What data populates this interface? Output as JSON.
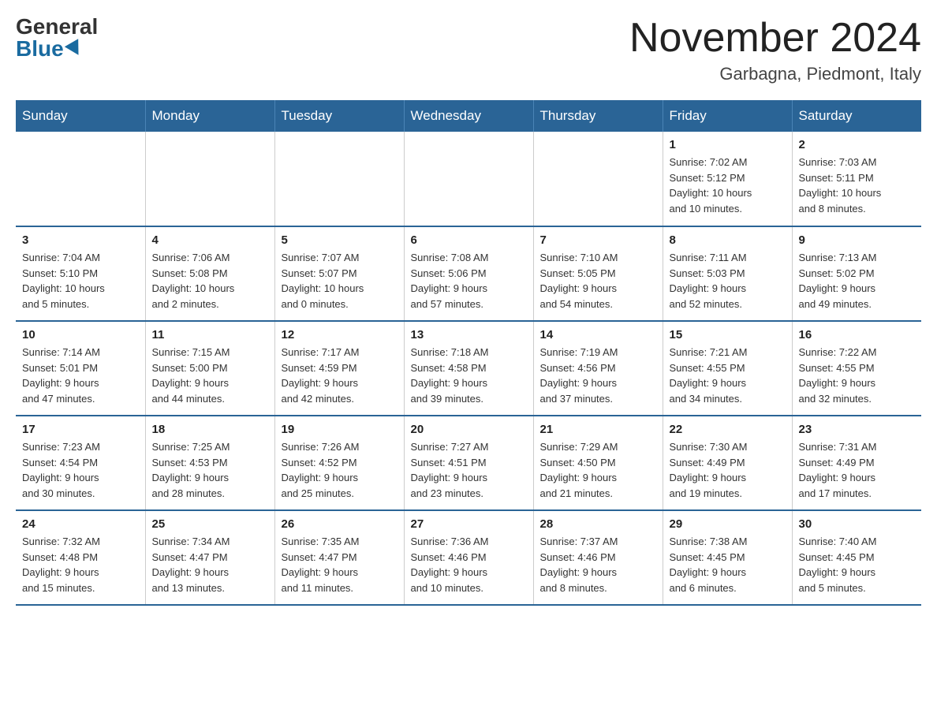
{
  "header": {
    "logo_general": "General",
    "logo_blue": "Blue",
    "month_title": "November 2024",
    "location": "Garbagna, Piedmont, Italy"
  },
  "days_of_week": [
    "Sunday",
    "Monday",
    "Tuesday",
    "Wednesday",
    "Thursday",
    "Friday",
    "Saturday"
  ],
  "weeks": [
    [
      {
        "day": "",
        "info": ""
      },
      {
        "day": "",
        "info": ""
      },
      {
        "day": "",
        "info": ""
      },
      {
        "day": "",
        "info": ""
      },
      {
        "day": "",
        "info": ""
      },
      {
        "day": "1",
        "info": "Sunrise: 7:02 AM\nSunset: 5:12 PM\nDaylight: 10 hours\nand 10 minutes."
      },
      {
        "day": "2",
        "info": "Sunrise: 7:03 AM\nSunset: 5:11 PM\nDaylight: 10 hours\nand 8 minutes."
      }
    ],
    [
      {
        "day": "3",
        "info": "Sunrise: 7:04 AM\nSunset: 5:10 PM\nDaylight: 10 hours\nand 5 minutes."
      },
      {
        "day": "4",
        "info": "Sunrise: 7:06 AM\nSunset: 5:08 PM\nDaylight: 10 hours\nand 2 minutes."
      },
      {
        "day": "5",
        "info": "Sunrise: 7:07 AM\nSunset: 5:07 PM\nDaylight: 10 hours\nand 0 minutes."
      },
      {
        "day": "6",
        "info": "Sunrise: 7:08 AM\nSunset: 5:06 PM\nDaylight: 9 hours\nand 57 minutes."
      },
      {
        "day": "7",
        "info": "Sunrise: 7:10 AM\nSunset: 5:05 PM\nDaylight: 9 hours\nand 54 minutes."
      },
      {
        "day": "8",
        "info": "Sunrise: 7:11 AM\nSunset: 5:03 PM\nDaylight: 9 hours\nand 52 minutes."
      },
      {
        "day": "9",
        "info": "Sunrise: 7:13 AM\nSunset: 5:02 PM\nDaylight: 9 hours\nand 49 minutes."
      }
    ],
    [
      {
        "day": "10",
        "info": "Sunrise: 7:14 AM\nSunset: 5:01 PM\nDaylight: 9 hours\nand 47 minutes."
      },
      {
        "day": "11",
        "info": "Sunrise: 7:15 AM\nSunset: 5:00 PM\nDaylight: 9 hours\nand 44 minutes."
      },
      {
        "day": "12",
        "info": "Sunrise: 7:17 AM\nSunset: 4:59 PM\nDaylight: 9 hours\nand 42 minutes."
      },
      {
        "day": "13",
        "info": "Sunrise: 7:18 AM\nSunset: 4:58 PM\nDaylight: 9 hours\nand 39 minutes."
      },
      {
        "day": "14",
        "info": "Sunrise: 7:19 AM\nSunset: 4:56 PM\nDaylight: 9 hours\nand 37 minutes."
      },
      {
        "day": "15",
        "info": "Sunrise: 7:21 AM\nSunset: 4:55 PM\nDaylight: 9 hours\nand 34 minutes."
      },
      {
        "day": "16",
        "info": "Sunrise: 7:22 AM\nSunset: 4:55 PM\nDaylight: 9 hours\nand 32 minutes."
      }
    ],
    [
      {
        "day": "17",
        "info": "Sunrise: 7:23 AM\nSunset: 4:54 PM\nDaylight: 9 hours\nand 30 minutes."
      },
      {
        "day": "18",
        "info": "Sunrise: 7:25 AM\nSunset: 4:53 PM\nDaylight: 9 hours\nand 28 minutes."
      },
      {
        "day": "19",
        "info": "Sunrise: 7:26 AM\nSunset: 4:52 PM\nDaylight: 9 hours\nand 25 minutes."
      },
      {
        "day": "20",
        "info": "Sunrise: 7:27 AM\nSunset: 4:51 PM\nDaylight: 9 hours\nand 23 minutes."
      },
      {
        "day": "21",
        "info": "Sunrise: 7:29 AM\nSunset: 4:50 PM\nDaylight: 9 hours\nand 21 minutes."
      },
      {
        "day": "22",
        "info": "Sunrise: 7:30 AM\nSunset: 4:49 PM\nDaylight: 9 hours\nand 19 minutes."
      },
      {
        "day": "23",
        "info": "Sunrise: 7:31 AM\nSunset: 4:49 PM\nDaylight: 9 hours\nand 17 minutes."
      }
    ],
    [
      {
        "day": "24",
        "info": "Sunrise: 7:32 AM\nSunset: 4:48 PM\nDaylight: 9 hours\nand 15 minutes."
      },
      {
        "day": "25",
        "info": "Sunrise: 7:34 AM\nSunset: 4:47 PM\nDaylight: 9 hours\nand 13 minutes."
      },
      {
        "day": "26",
        "info": "Sunrise: 7:35 AM\nSunset: 4:47 PM\nDaylight: 9 hours\nand 11 minutes."
      },
      {
        "day": "27",
        "info": "Sunrise: 7:36 AM\nSunset: 4:46 PM\nDaylight: 9 hours\nand 10 minutes."
      },
      {
        "day": "28",
        "info": "Sunrise: 7:37 AM\nSunset: 4:46 PM\nDaylight: 9 hours\nand 8 minutes."
      },
      {
        "day": "29",
        "info": "Sunrise: 7:38 AM\nSunset: 4:45 PM\nDaylight: 9 hours\nand 6 minutes."
      },
      {
        "day": "30",
        "info": "Sunrise: 7:40 AM\nSunset: 4:45 PM\nDaylight: 9 hours\nand 5 minutes."
      }
    ]
  ]
}
